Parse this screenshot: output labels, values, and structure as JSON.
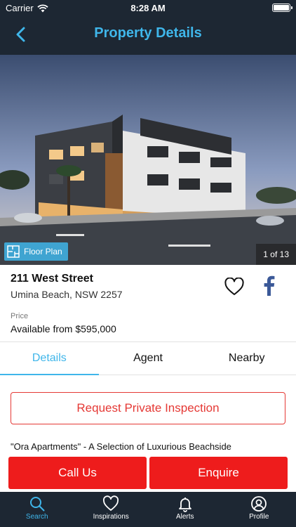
{
  "status_bar": {
    "carrier": "Carrier",
    "time": "8:28 AM"
  },
  "header": {
    "title": "Property Details",
    "back_icon": "chevron-left-icon"
  },
  "hero": {
    "floor_plan_label": "Floor Plan",
    "image_counter": "1 of 13"
  },
  "property": {
    "address": "211 West Street",
    "suburb": "Umina Beach, NSW 2257",
    "price_label": "Price",
    "price": "Available from $595,000"
  },
  "tabs": [
    {
      "label": "Details",
      "active": true
    },
    {
      "label": "Agent",
      "active": false
    },
    {
      "label": "Nearby",
      "active": false
    }
  ],
  "inspection_button": "Request Private Inspection",
  "description_preview": "\"Ora Apartments\" - A Selection of Luxurious Beachside",
  "actions": {
    "call": "Call Us",
    "enquire": "Enquire"
  },
  "tab_bar": [
    {
      "label": "Search",
      "icon": "search-icon",
      "active": true
    },
    {
      "label": "Inspirations",
      "icon": "heart-icon",
      "active": false
    },
    {
      "label": "Alerts",
      "icon": "bell-icon",
      "active": false
    },
    {
      "label": "Profile",
      "icon": "user-icon",
      "active": false
    }
  ],
  "colors": {
    "accent": "#3fb6ea",
    "header_bg": "#1d2733",
    "action_red": "#ee1c1c",
    "facebook_blue": "#3b5998"
  }
}
